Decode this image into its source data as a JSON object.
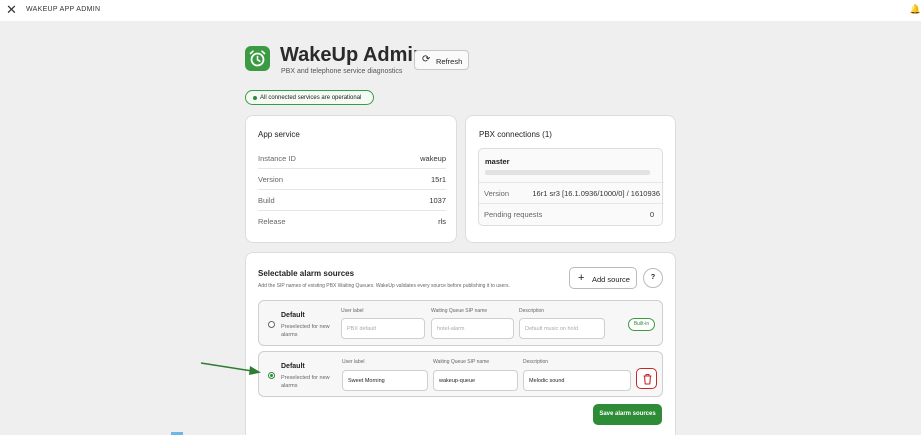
{
  "topbar": {
    "close_icon": "close-icon",
    "title": "WAKEUP APP ADMIN",
    "corner_icon": "bell-icon"
  },
  "header": {
    "title": "WakeUp Admin",
    "subtitle": "PBX and telephone service diagnostics",
    "refresh_label": "Refresh",
    "app_icon": "alarm-clock-icon",
    "brand_color": "#3a9b43"
  },
  "status": {
    "text": "All connected services are operational",
    "color": "#2e8b36"
  },
  "app_service": {
    "title": "App service",
    "rows": [
      {
        "key": "Instance ID",
        "value": "wakeup"
      },
      {
        "key": "Version",
        "value": "15r1"
      },
      {
        "key": "Build",
        "value": "1037"
      },
      {
        "key": "Release",
        "value": "rls"
      }
    ]
  },
  "pbx": {
    "title": "PBX connections (1)",
    "connection": {
      "name": "master",
      "version_label": "Version",
      "version_value": "16r1 sr3 [16.1.0936/1000/0] / 1610936",
      "pending_label": "Pending requests",
      "pending_value": "0"
    }
  },
  "alarm": {
    "title": "Selectable alarm sources",
    "subtitle": "Add the SIP names of existing PBX Waiting Queues. WakeUp validates every source before publishing it to users.",
    "add_label": "Add source",
    "help_label": "?",
    "labels": {
      "user": "User label",
      "queue": "Waiting Queue SIP name",
      "desc": "Description"
    },
    "sources": [
      {
        "title": "Default",
        "preselect": "Preselected for new alarms",
        "selected": false,
        "user_placeholder": "PBX default",
        "queue_placeholder": "hotel-alarm",
        "desc_placeholder": "Default music on hold",
        "badge": "Built-in"
      },
      {
        "title": "Default",
        "preselect": "Preselected for new alarms",
        "selected": true,
        "user_value": "Sweet Morning",
        "queue_value": "wakeup-queue",
        "desc_value": "Melodic sound"
      }
    ],
    "save_label": "Save alarm sources",
    "danger_color": "#c62828"
  }
}
